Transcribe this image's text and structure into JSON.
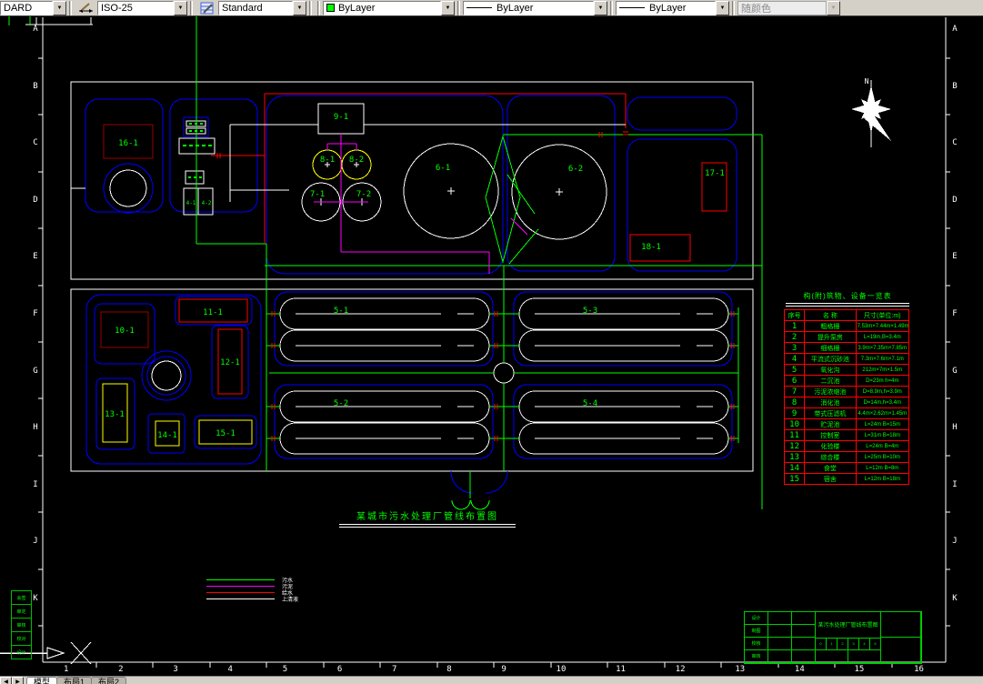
{
  "toolbar": {
    "dimstyle_value": "DARD",
    "dim_value": "ISO-25",
    "textstyle_value": "Standard",
    "color_value": "ByLayer",
    "linetype_value": "ByLayer",
    "lineweight_value": "ByLayer",
    "plotstyle_value": "随颜色",
    "color_swatch": "#00ff00",
    "dropdown_glyph": "▼"
  },
  "frame": {
    "row_letters": [
      "A",
      "B",
      "C",
      "D",
      "E",
      "F",
      "G",
      "H",
      "I",
      "J",
      "K"
    ],
    "col_numbers": [
      "1",
      "2",
      "3",
      "4",
      "5",
      "6",
      "7",
      "8",
      "9",
      "10",
      "11",
      "12",
      "13",
      "14",
      "15",
      "16"
    ]
  },
  "drawing": {
    "title": "某城市污水处理厂管线布置图",
    "compass_label": "N",
    "ucs_axis": "X",
    "units": {
      "u16_1": "16-1",
      "u9_1": "9-1",
      "u8_1": "8-1",
      "u8_2": "8-2",
      "u7_1": "7-1",
      "u7_2": "7-2",
      "u6_1": "6-1",
      "u6_2": "6-2",
      "u17_1": "17-1",
      "u18_1": "18-1",
      "u5_1": "5-1",
      "u5_2": "5-2",
      "u5_3": "5-3",
      "u5_4": "5-4",
      "u10_1": "10-1",
      "u11_1": "11-1",
      "u12_1": "12-1",
      "u13_1": "13-1",
      "u14_1": "14-1",
      "u15_1": "15-1",
      "u4_1": "4-1",
      "u4_2": "4-2"
    },
    "pipe_legend": [
      {
        "label": "污水",
        "color": "#00ff00"
      },
      {
        "label": "污泥",
        "color": "#ff00ff"
      },
      {
        "label": "给水",
        "color": "#ff0000"
      },
      {
        "label": "上清液",
        "color": "#ffffff"
      }
    ]
  },
  "table": {
    "title": "构(附)筑物、设备一览表",
    "headers": [
      "序号",
      "名  称",
      "尺寸(单位:m)"
    ],
    "rows": [
      {
        "no": "1",
        "name": "粗格栅",
        "size": "7.53m×7.44m×1.49m"
      },
      {
        "no": "2",
        "name": "提升泵房",
        "size": "L=19m,B=3.4m"
      },
      {
        "no": "3",
        "name": "细格栅",
        "size": "3.9m×7.35m×7.85m"
      },
      {
        "no": "4",
        "name": "平流式沉砂池",
        "size": "7.3m×7.6m×7.1m"
      },
      {
        "no": "5",
        "name": "氧化沟",
        "size": "212m×7m×1.5m"
      },
      {
        "no": "6",
        "name": "二沉池",
        "size": "D=23m h=4m"
      },
      {
        "no": "7",
        "name": "污泥浓缩池",
        "size": "D=8.9m,h=3.9m"
      },
      {
        "no": "8",
        "name": "消化池",
        "size": "D=14m,h=3.4m"
      },
      {
        "no": "9",
        "name": "带式压滤机",
        "size": "4.4m×2.62m×1.45m"
      },
      {
        "no": "10",
        "name": "贮泥池",
        "size": "L=24m B=15m"
      },
      {
        "no": "11",
        "name": "控制室",
        "size": "L=31m B=18m"
      },
      {
        "no": "12",
        "name": "化验楼",
        "size": "L=24m B=4m"
      },
      {
        "no": "13",
        "name": "综合楼",
        "size": "L=25m B=10m"
      },
      {
        "no": "14",
        "name": "食堂",
        "size": "L=12m B=8m"
      },
      {
        "no": "15",
        "name": "宿舍",
        "size": "L=12m B=18m"
      }
    ]
  },
  "side_strip": [
    "会签",
    "审定",
    "审核",
    "校对",
    "设计"
  ],
  "titleblock": {
    "project": "某污水处理厂管线布置图",
    "left_rows": [
      "设计",
      "制图",
      "校核",
      "审核"
    ],
    "scale_numbers": [
      "0",
      "1",
      "2",
      "3",
      "4",
      "5"
    ]
  },
  "tabs": {
    "nav_prev": "◀",
    "nav_next": "▶",
    "items": [
      "模型",
      "布局1",
      "布局2"
    ]
  }
}
